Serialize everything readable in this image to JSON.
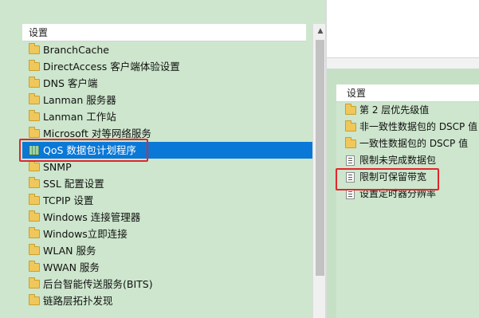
{
  "left_panel": {
    "header": "设置",
    "scroll_up_glyph": "▲",
    "items": [
      {
        "label": "BranchCache",
        "icon": "folder-icon"
      },
      {
        "label": "DirectAccess 客户端体验设置",
        "icon": "folder-icon"
      },
      {
        "label": "DNS 客户端",
        "icon": "folder-icon"
      },
      {
        "label": "Lanman 服务器",
        "icon": "folder-icon"
      },
      {
        "label": "Lanman 工作站",
        "icon": "folder-icon"
      },
      {
        "label": "Microsoft 对等网络服务",
        "icon": "folder-icon"
      },
      {
        "label": "QoS 数据包计划程序",
        "icon": "qos-icon",
        "selected": true
      },
      {
        "label": "SNMP",
        "icon": "folder-icon"
      },
      {
        "label": "SSL 配置设置",
        "icon": "folder-icon"
      },
      {
        "label": "TCPIP 设置",
        "icon": "folder-icon"
      },
      {
        "label": "Windows 连接管理器",
        "icon": "folder-icon"
      },
      {
        "label": "Windows立即连接",
        "icon": "folder-icon"
      },
      {
        "label": "WLAN 服务",
        "icon": "folder-icon"
      },
      {
        "label": "WWAN 服务",
        "icon": "folder-icon"
      },
      {
        "label": "后台智能传送服务(BITS)",
        "icon": "folder-icon"
      },
      {
        "label": "链路层拓扑发现",
        "icon": "folder-icon"
      }
    ]
  },
  "right_panel": {
    "header": "设置",
    "items": [
      {
        "label": "第 2 层优先级值",
        "icon": "folder-icon"
      },
      {
        "label": "非一致性数据包的 DSCP 值",
        "icon": "folder-icon"
      },
      {
        "label": "一致性数据包的 DSCP 值",
        "icon": "folder-icon"
      },
      {
        "label": "限制未完成数据包",
        "icon": "policy-icon"
      },
      {
        "label": "限制可保留带宽",
        "icon": "policy-icon",
        "highlighted": true
      },
      {
        "label": "设置定时器分辨率",
        "icon": "policy-icon"
      }
    ]
  },
  "colors": {
    "selection": "#0a78d7",
    "highlight_box": "#e2262b",
    "panel_bg": "#cde6cd"
  }
}
